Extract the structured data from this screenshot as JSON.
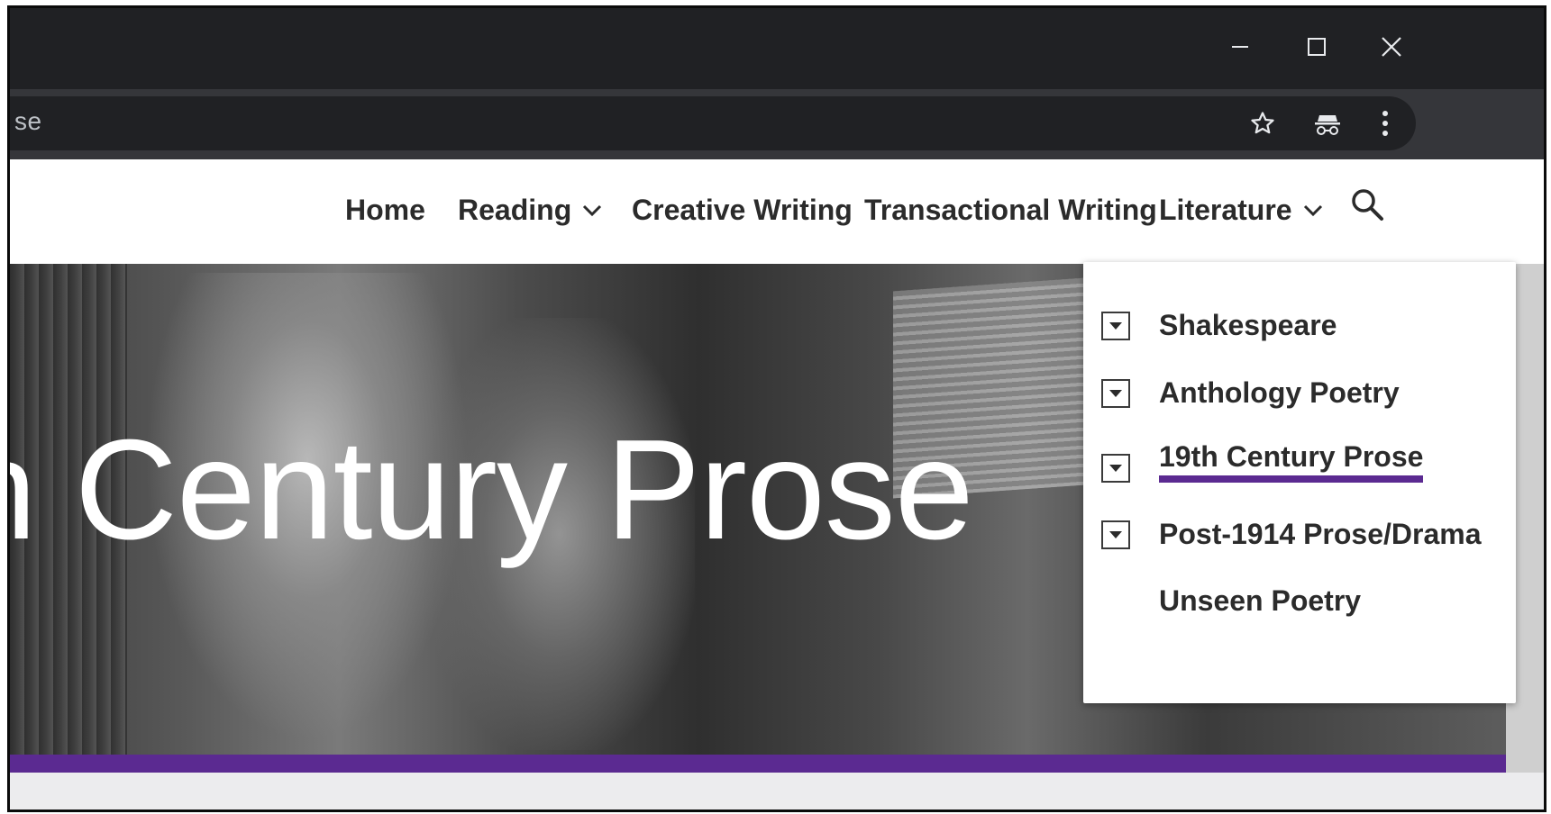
{
  "browser": {
    "url_fragment": "se",
    "window_controls": [
      "minimize",
      "maximize",
      "close"
    ],
    "toolbar_icons": [
      "star-icon",
      "incognito-icon",
      "kebab-menu-icon"
    ]
  },
  "nav": {
    "items": [
      {
        "label": "Home",
        "has_dropdown": false
      },
      {
        "label": "Reading",
        "has_dropdown": true
      },
      {
        "label": "Creative Writing",
        "has_dropdown": false
      },
      {
        "label": "Transactional Writing",
        "has_dropdown": false
      },
      {
        "label": "Literature",
        "has_dropdown": true
      }
    ],
    "search_icon": "search-icon"
  },
  "hero": {
    "title": "h Century Prose"
  },
  "literature_menu": {
    "items": [
      {
        "label": "Shakespeare",
        "expandable": true,
        "active": false
      },
      {
        "label": "Anthology Poetry",
        "expandable": true,
        "active": false
      },
      {
        "label": "19th Century Prose",
        "expandable": true,
        "active": true
      },
      {
        "label": "Post-1914 Prose/Drama",
        "expandable": true,
        "active": false
      },
      {
        "label": "Unseen Poetry",
        "expandable": false,
        "active": false
      }
    ]
  },
  "colors": {
    "accent": "#5b2a91",
    "titlebar": "#202124",
    "toolbar": "#35363a"
  }
}
